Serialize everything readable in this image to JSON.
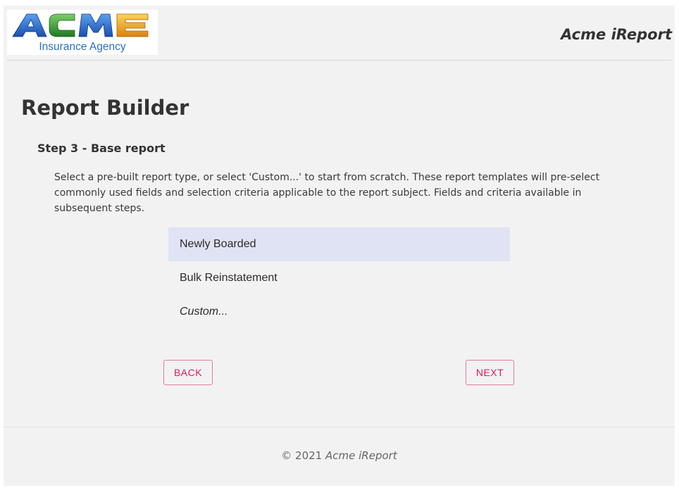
{
  "header": {
    "logo": {
      "brand_text": "ACME",
      "sub_text": "Insurance Agency",
      "letter_colors": [
        "#1f5fbf",
        "#2b8f2b",
        "#1f5fbf",
        "#e3a21a"
      ]
    },
    "app_title": "Acme iReport"
  },
  "main": {
    "page_title": "Report Builder",
    "step_title": "Step 3 - Base report",
    "description": "Select a pre-built report type, or select 'Custom...' to start from scratch. These report templates will pre-select commonly used fields and selection criteria applicable to the report subject. Fields and criteria available in subsequent steps.",
    "report_types": [
      {
        "label": "Newly Boarded",
        "selected": true
      },
      {
        "label": "Bulk Reinstatement",
        "selected": false
      },
      {
        "label": "Custom...",
        "selected": false
      }
    ],
    "buttons": {
      "back_label": "BACK",
      "next_label": "NEXT"
    }
  },
  "footer": {
    "copyright": "© 2021",
    "brand": "Acme iReport"
  },
  "colors": {
    "accent": "#e0195c",
    "selected_bg": "#e0e3f3",
    "page_bg": "#f2f2f2"
  }
}
